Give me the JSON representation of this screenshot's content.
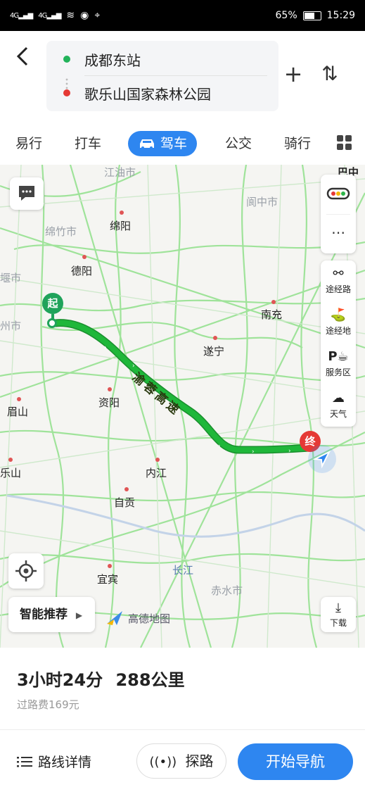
{
  "status_bar": {
    "signal1": "4G",
    "signal2": "4G",
    "battery": "65%",
    "time": "15:29"
  },
  "route": {
    "origin": "成都东站",
    "destination": "歌乐山国家森林公园"
  },
  "tabs": [
    "易行",
    "打车",
    "驾车",
    "公交",
    "骑行"
  ],
  "active_tab": "驾车",
  "map": {
    "cities": [
      "江油市",
      "阆中市",
      "绵竹市",
      "绵阳",
      "德阳",
      "南充",
      "遂宁",
      "资阳",
      "眉山",
      "内江",
      "乐山",
      "自贡",
      "宜宾",
      "长江",
      "赤水市"
    ],
    "edge_labels": [
      "堰市",
      "州市",
      "巴中"
    ],
    "start_marker": "起",
    "end_marker": "终",
    "road_name": "渝蓉高速",
    "logo": "高德地图"
  },
  "side_tools": {
    "via_route": "途经路",
    "via_place": "途经地",
    "service": "服务区",
    "weather": "天气",
    "download": "下载"
  },
  "smart_recommend": "智能推荐",
  "summary": {
    "time": "3小时24分",
    "distance": "288公里",
    "toll": "过路费169元"
  },
  "actions": {
    "details": "路线详情",
    "explore": "探路",
    "navigate": "开始导航"
  },
  "colors": {
    "accent": "#2e86f0",
    "route": "#1fb73a",
    "origin_dot": "#22b35a",
    "dest_dot": "#e53935"
  }
}
